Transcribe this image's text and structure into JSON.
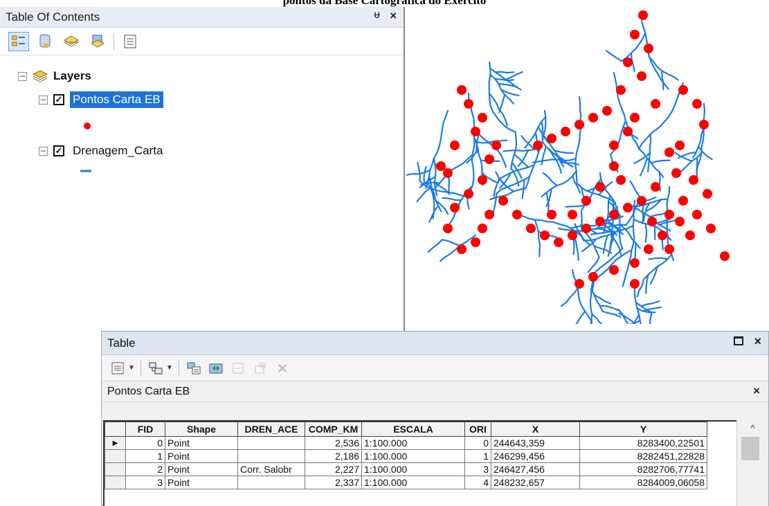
{
  "caption": "pontos da Base Cartográfica do Exército",
  "toc": {
    "title": "Table Of Contents",
    "pin": "ᵾ",
    "close": "×",
    "group_label": "Layers",
    "layers": [
      {
        "name": "Pontos Carta EB",
        "checked": "✓",
        "symbol": "red-point"
      },
      {
        "name": "Drenagem_Carta",
        "checked": "✓",
        "symbol": "blue-line"
      }
    ],
    "expander": "−"
  },
  "table_window": {
    "title": "Table",
    "close": "×",
    "layer_name": "Pontos Carta EB",
    "layer_close": "×",
    "columns": [
      "FID",
      "Shape",
      "DREN_ACE",
      "COMP_KM",
      "ESCALA",
      "ORI",
      "X",
      "Y"
    ],
    "rows": [
      [
        "0",
        "Point",
        "",
        "2,536",
        "1:100.000",
        "0",
        "244643,359",
        "8283400,22501"
      ],
      [
        "1",
        "Point",
        "",
        "2,186",
        "1:100.000",
        "1",
        "246299,456",
        "8282451,22828"
      ],
      [
        "2",
        "Point",
        "Corr. Salobr",
        "2,227",
        "1:100.000",
        "3",
        "246427,456",
        "8282706,77741"
      ],
      [
        "3",
        "Point",
        "",
        "2,337",
        "1:100.000",
        "4",
        "248232,657",
        "8284009,06058"
      ]
    ],
    "current_row_marker": "▶",
    "scroll_up": "^"
  },
  "colors": {
    "point": "#ff0000",
    "drainage": "#1a7be6",
    "selection": "#1e73d9"
  }
}
